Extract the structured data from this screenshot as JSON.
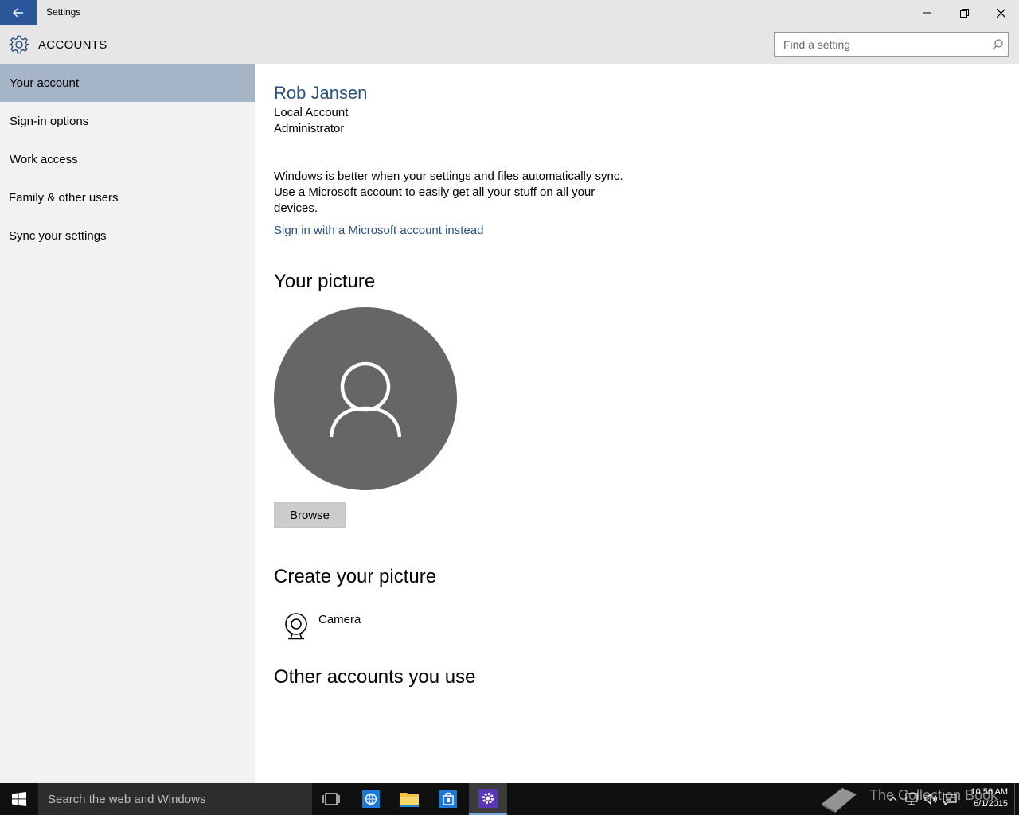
{
  "window": {
    "title": "Settings"
  },
  "header": {
    "section_title": "ACCOUNTS",
    "search_placeholder": "Find a setting"
  },
  "sidebar": {
    "items": [
      {
        "label": "Your account",
        "active": true
      },
      {
        "label": "Sign-in options",
        "active": false
      },
      {
        "label": "Work access",
        "active": false
      },
      {
        "label": "Family & other users",
        "active": false
      },
      {
        "label": "Sync your settings",
        "active": false
      }
    ]
  },
  "account": {
    "name": "Rob Jansen",
    "type": "Local Account",
    "role": "Administrator",
    "sync_message": "Windows is better when your settings and files automatically sync. Use a Microsoft account to easily get all your stuff on all your devices.",
    "sign_in_link": "Sign in with a Microsoft account instead"
  },
  "picture": {
    "heading": "Your picture",
    "browse_label": "Browse"
  },
  "create_picture": {
    "heading": "Create your picture",
    "camera_label": "Camera"
  },
  "other_accounts": {
    "heading": "Other accounts you use"
  },
  "taskbar": {
    "search_placeholder": "Search the web and Windows",
    "watermark": "The Collection Book",
    "time": "10:56 AM",
    "date": "6/1/2015"
  },
  "colors": {
    "accent": "#2b579a",
    "link": "#2b5079",
    "nav_active": "#a6b4c8",
    "avatar_bg": "#666666"
  }
}
